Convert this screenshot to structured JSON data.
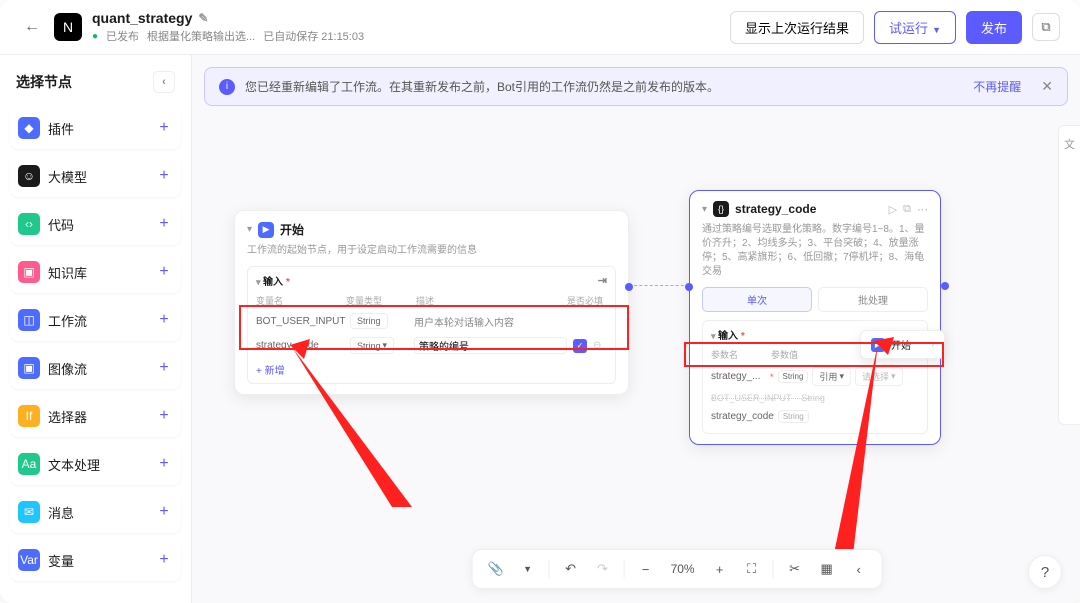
{
  "header": {
    "title": "quant_strategy",
    "published_label": "已发布",
    "subtitle": "根据量化策略输出选...",
    "autosave": "已自动保存 21:15:03",
    "btn_results": "显示上次运行结果",
    "btn_testrun": "试运行",
    "btn_publish": "发布"
  },
  "sidebar": {
    "title": "选择节点",
    "items": [
      {
        "label": "插件",
        "color": "#4e6bff"
      },
      {
        "label": "大模型",
        "color": "#1a1a1a"
      },
      {
        "label": "代码",
        "color": "#1fc98b"
      },
      {
        "label": "知识库",
        "color": "#ff5b8f"
      },
      {
        "label": "工作流",
        "color": "#4e6bff"
      },
      {
        "label": "图像流",
        "color": "#4e6bff"
      },
      {
        "label": "选择器",
        "color": "#ffb020"
      },
      {
        "label": "文本处理",
        "color": "#1fc98b"
      },
      {
        "label": "消息",
        "color": "#20c4ff"
      },
      {
        "label": "变量",
        "color": "#4e6bff"
      }
    ]
  },
  "notice": {
    "text": "您已经重新编辑了工作流。在其重新发布之前，Bot引用的工作流仍然是之前发布的版本。",
    "dismiss": "不再提醒"
  },
  "node_start": {
    "title": "开始",
    "desc": "工作流的起始节点，用于设定启动工作流需要的信息",
    "section_title": "输入",
    "col_name": "变量名",
    "col_type": "变量类型",
    "col_desc": "描述",
    "col_req": "是否必填",
    "rows": [
      {
        "name": "BOT_USER_INPUT",
        "type": "String",
        "desc": "用户本轮对话输入内容",
        "required": false
      },
      {
        "name": "strategy_code",
        "type": "String",
        "desc": "策略的编号",
        "required": true
      }
    ],
    "add_label": "新增"
  },
  "node_strategy": {
    "title": "strategy_code",
    "desc": "通过策略编号选取量化策略。数字编号1~8。1、量价齐升；2、均线多头；3、平台突破；4、放量涨停；5、高紧旗形；6、低回撤；7停机坪；8、海龟交易",
    "tab_single": "单次",
    "tab_batch": "批处理",
    "section_title": "输入",
    "col_name": "参数名",
    "col_val": "参数值",
    "row_name": "strategy_...",
    "row_type": "String",
    "ref_label": "引用",
    "select_placeholder": "请选择",
    "dropdown_row1_name": "BOT_USER_INPUT",
    "dropdown_row1_type": "String",
    "dropdown_row2_name": "strategy_code",
    "dropdown_row2_type": "String"
  },
  "popup": {
    "icon_bg": "#4e6bff",
    "label": "开始"
  },
  "toolbar": {
    "zoom": "70%"
  }
}
